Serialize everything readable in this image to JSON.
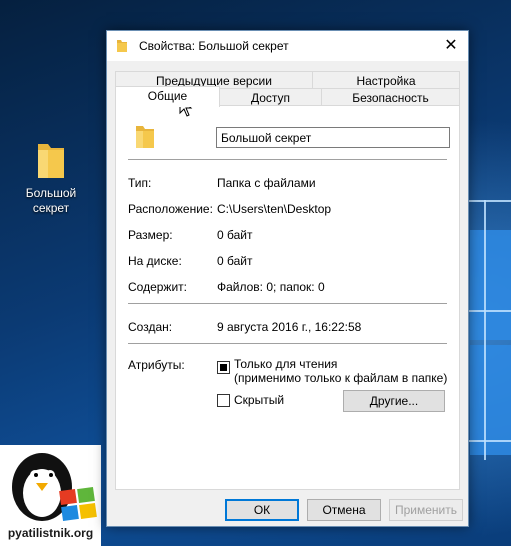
{
  "desktop": {
    "icon_label_line1": "Большой",
    "icon_label_line2": "секрет",
    "watermark_text": "pyatilistnik.org"
  },
  "dialog": {
    "title": "Свойства: Большой секрет",
    "close_glyph": "✕",
    "tabs_top": [
      "Предыдущие версии",
      "Настройка"
    ],
    "tabs_bottom": [
      "Общие",
      "Доступ",
      "Безопасность"
    ],
    "active_tab": "Общие",
    "name_value": "Большой секрет",
    "properties": [
      {
        "label": "Тип:",
        "value": "Папка с файлами"
      },
      {
        "label": "Расположение:",
        "value": "C:\\Users\\ten\\Desktop"
      },
      {
        "label": "Размер:",
        "value": "0 байт"
      },
      {
        "label": "На диске:",
        "value": "0 байт"
      },
      {
        "label": "Содержит:",
        "value": "Файлов: 0; папок: 0"
      }
    ],
    "created_label": "Создан:",
    "created_value": "9 августа 2016 г., 16:22:58",
    "attributes_label": "Атрибуты:",
    "readonly_label_line1": "Только для чтения",
    "readonly_label_line2": "(применимо только к файлам в папке)",
    "readonly_state": "indeterminate",
    "hidden_label": "Скрытый",
    "hidden_checked": false,
    "other_button": "Другие...",
    "ok_button": "ОК",
    "cancel_button": "Отмена",
    "apply_button": "Применить"
  },
  "colors": {
    "folder_yellow": "#f5c84c",
    "accent_blue": "#0078d7"
  }
}
